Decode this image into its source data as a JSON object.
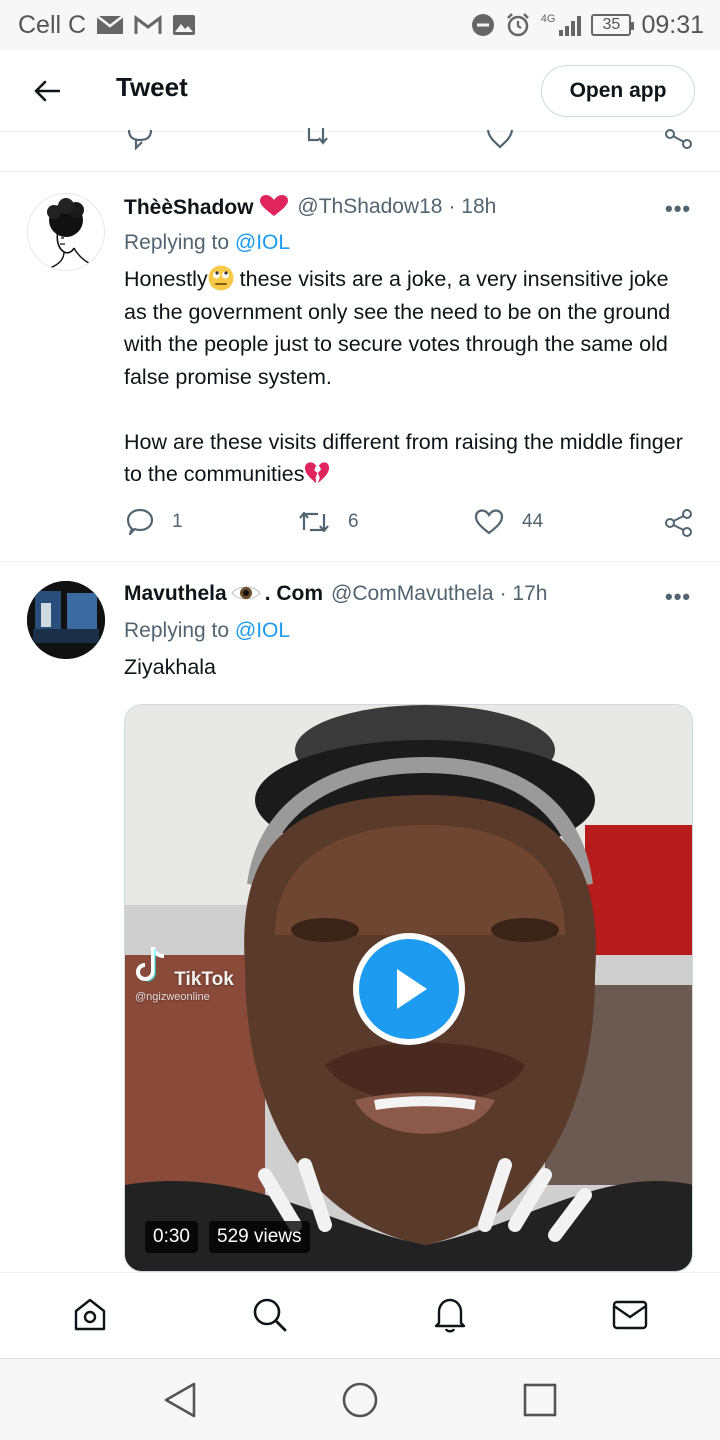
{
  "status_bar": {
    "carrier": "Cell C",
    "time": "09:31",
    "battery": "35",
    "network": "4G"
  },
  "header": {
    "title": "Tweet",
    "open_app_label": "Open app"
  },
  "tweets": [
    {
      "name": "ThèèShadow",
      "handle": "@ThShadow18",
      "time": "· 18h",
      "reply_prefix": "Replying to",
      "reply_to": "@IOL",
      "text_1a": "Honestly",
      "text_1b": "these visits are a joke, a very insensitive joke as the government only see the need to be on the ground with the people just to secure votes through the same old false promise system.",
      "text_2": "How are these visits different from raising the middle finger to the communities",
      "replies": "1",
      "retweets": "6",
      "likes": "44"
    },
    {
      "name": "Mavuthela",
      "name_suffix": ". Com",
      "handle": "@ComMavuthela",
      "time": "· 17h",
      "reply_prefix": "Replying to",
      "reply_to": "@IOL",
      "text": "Ziyakhala",
      "video": {
        "duration": "0:30",
        "views": "529 views",
        "watermark": "TikTok",
        "watermark_handle": "@ngizweonline"
      }
    }
  ],
  "colors": {
    "accent": "#1d9bf0",
    "text": "#0f1419",
    "secondary": "#536471",
    "heart": "#e0245e"
  }
}
